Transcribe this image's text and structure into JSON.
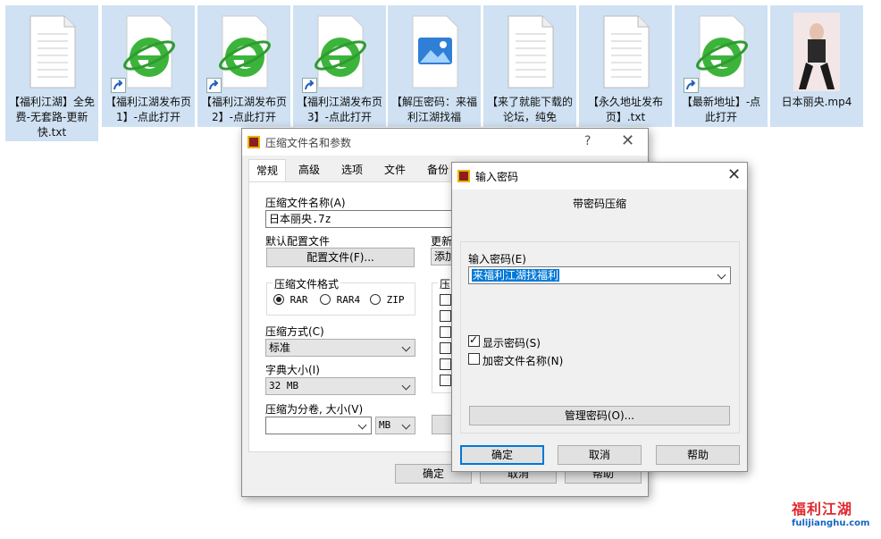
{
  "desktop": {
    "icons": [
      {
        "label": "【福利江湖】全免费-无套路-更新快.txt",
        "kind": "txt"
      },
      {
        "label": "【福利江湖发布页1】-点此打开",
        "kind": "ie"
      },
      {
        "label": "【福利江湖发布页2】-点此打开",
        "kind": "ie"
      },
      {
        "label": "【福利江湖发布页3】-点此打开",
        "kind": "ie"
      },
      {
        "label": "【解压密码：来福利江湖找福利】.jpg",
        "kind": "img"
      },
      {
        "label": "【来了就能下载的论坛，纯免费！】.txt",
        "kind": "txt"
      },
      {
        "label": "【永久地址发布页】.txt",
        "kind": "txt"
      },
      {
        "label": "【最新地址】-点此打开",
        "kind": "ie"
      },
      {
        "label": "日本丽央.mp4",
        "kind": "video"
      }
    ]
  },
  "archive_dialog": {
    "title": "压缩文件名和参数",
    "help": "?",
    "tabs": [
      "常规",
      "高级",
      "选项",
      "文件",
      "备份"
    ],
    "filename_label": "压缩文件名称(A)",
    "filename_value": "日本丽央.7z",
    "profile_label": "默认配置文件",
    "profile_button": "配置文件(F)...",
    "update_label": "更新",
    "update_value": "添加",
    "format_label": "压缩文件格式",
    "formats": [
      "RAR",
      "RAR4",
      "ZIP"
    ],
    "options_label": "压缩",
    "method_label": "压缩方式(C)",
    "method_value": "标准",
    "dict_label": "字典大小(I)",
    "dict_value": "32 MB",
    "split_label": "压缩为分卷, 大小(V)",
    "split_unit": "MB",
    "ok": "确定",
    "cancel": "取消",
    "help_btn": "帮助"
  },
  "password_dialog": {
    "title": "输入密码",
    "heading": "带密码压缩",
    "password_label": "输入密码(E)",
    "password_value": "来福利江湖找福利",
    "show_password": "显示密码(S)",
    "show_password_checked": true,
    "encrypt_names": "加密文件名称(N)",
    "encrypt_names_checked": false,
    "manage": "管理密码(O)...",
    "ok": "确定",
    "cancel": "取消",
    "help": "帮助"
  },
  "watermark": {
    "brand": "福利江湖",
    "url": "fulijianghu.com"
  }
}
